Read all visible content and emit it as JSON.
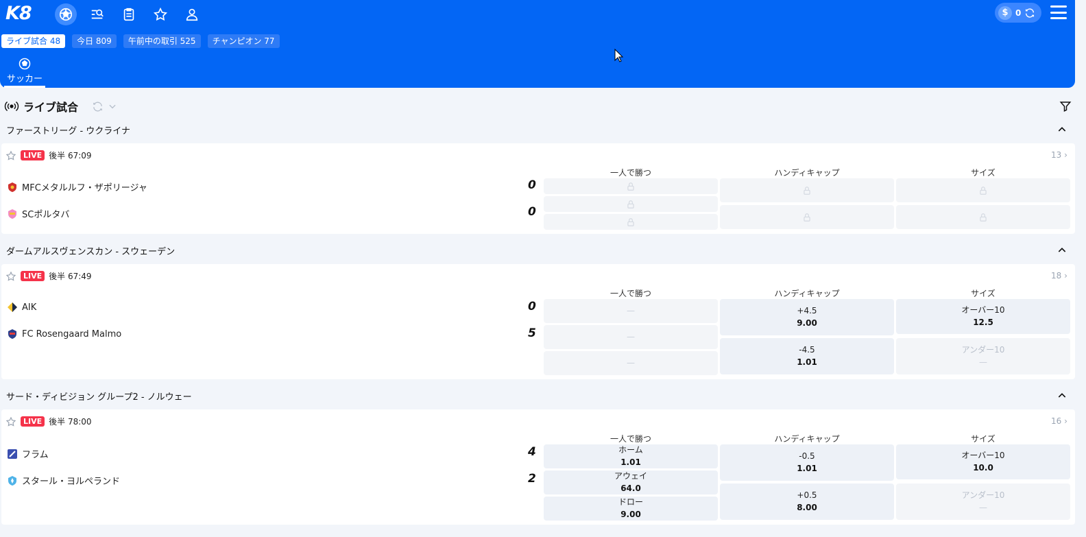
{
  "header": {
    "logo": "K8",
    "nav_icons": [
      "soccer-ball-icon",
      "search-list-icon",
      "clipboard-icon",
      "star-icon",
      "user-icon"
    ],
    "balance": "0",
    "currency_symbol": "$"
  },
  "filter_tabs": [
    {
      "label": "ライブ試合 48",
      "active": true
    },
    {
      "label": "今日 809",
      "active": false
    },
    {
      "label": "午前中の取引 525",
      "active": false
    },
    {
      "label": "チャンピオン 77",
      "active": false
    }
  ],
  "sport_tab": {
    "label": "サッカー"
  },
  "section": {
    "title": "ライブ試合"
  },
  "market_headers": [
    "一人で勝つ",
    "ハンディキャップ",
    "サイズ"
  ],
  "leagues": [
    {
      "name": "ファーストリーグ - ウクライナ",
      "match": {
        "live": "LIVE",
        "period": "後半 67:09",
        "more": "13",
        "home": {
          "name": "MFCメタルルフ・ザポリージャ",
          "score": "0"
        },
        "away": {
          "name": "SCポルタバ",
          "score": "0"
        }
      }
    },
    {
      "name": "ダームアルスヴェンスカン - スウェーデン",
      "match": {
        "live": "LIVE",
        "period": "後半 67:49",
        "more": "18",
        "home": {
          "name": "AIK",
          "score": "0"
        },
        "away": {
          "name": "FC Rosengaard Malmo",
          "score": "5"
        },
        "handicap": [
          {
            "line": "+4.5",
            "odd": "9.00"
          },
          {
            "line": "-4.5",
            "odd": "1.01"
          }
        ],
        "size": [
          {
            "line": "オーバー10",
            "odd": "12.5"
          },
          {
            "line": "アンダー10",
            "odd": "—"
          }
        ],
        "win_dash": "—"
      }
    },
    {
      "name": "サード・ディビジョン グループ2 - ノルウェー",
      "match": {
        "live": "LIVE",
        "period": "後半 78:00",
        "more": "16",
        "home": {
          "name": "フラム",
          "score": "4"
        },
        "away": {
          "name": "スタール・ヨルペランド",
          "score": "2"
        },
        "win": [
          {
            "line": "ホーム",
            "odd": "1.01"
          },
          {
            "line": "アウェイ",
            "odd": "64.0"
          },
          {
            "line": "ドロー",
            "odd": "9.00"
          }
        ],
        "handicap": [
          {
            "line": "-0.5",
            "odd": "1.01"
          },
          {
            "line": "+0.5",
            "odd": "8.00"
          }
        ],
        "size": [
          {
            "line": "オーバー10",
            "odd": "10.0"
          },
          {
            "line": "アンダー10",
            "odd": "—"
          }
        ]
      }
    }
  ],
  "colors": {
    "primary": "#0366f5",
    "live": "#f5334a",
    "cell": "#edf1f7",
    "bg": "#f2f5fa"
  }
}
